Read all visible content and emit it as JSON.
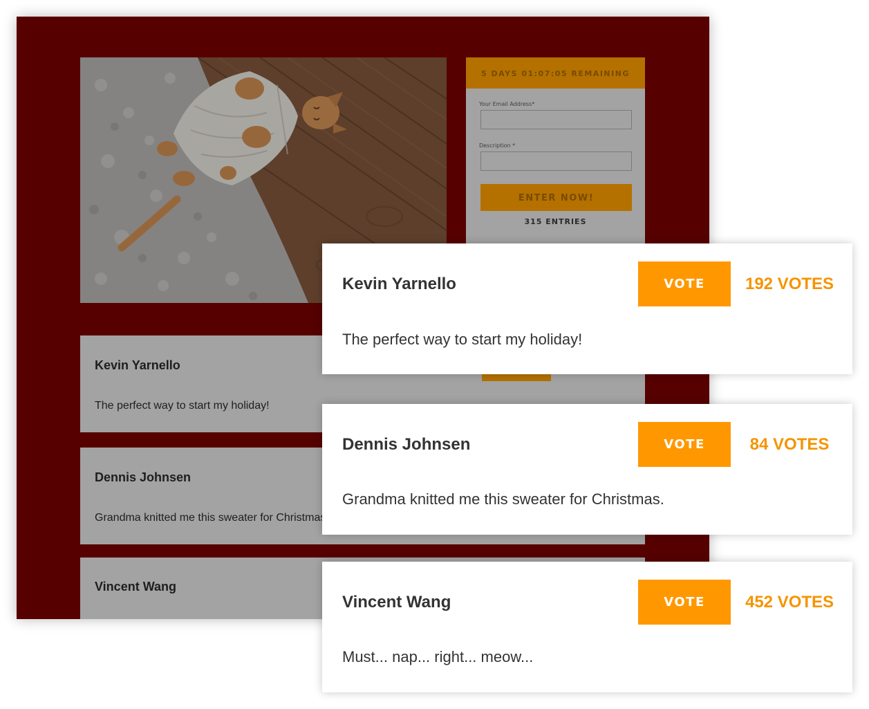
{
  "background_page": {
    "hero_image": {
      "icon": "kitten-in-sweater-photo"
    },
    "contest_form": {
      "timer": "5 DAYS 01:07:05 REMAINING",
      "email_label": "Your Email Address*",
      "email_value": "",
      "description_label": "Description *",
      "description_value": "",
      "submit_label": "ENTER NOW!",
      "entries_count": "315 ENTRIES"
    },
    "entries": [
      {
        "name": "Kevin Yarnello",
        "description": "The perfect way to start my holiday!"
      },
      {
        "name": "Dennis Johnsen",
        "description": "Grandma knitted me this sweater for Christmas."
      },
      {
        "name": "Vincent Wang",
        "description": ""
      }
    ]
  },
  "entries": [
    {
      "name": "Kevin Yarnello",
      "vote_label": "VOTE",
      "votes": "192 VOTES",
      "description": "The perfect way to start my holiday!"
    },
    {
      "name": "Dennis Johnsen",
      "vote_label": "VOTE",
      "votes": "84 VOTES",
      "description": "Grandma knitted me this sweater for Christmas."
    },
    {
      "name": "Vincent Wang",
      "vote_label": "VOTE",
      "votes": "452 VOTES",
      "description": "Must... nap... right... meow..."
    }
  ],
  "colors": {
    "background_page": "#560000",
    "accent": "#ff9800",
    "vote_count": "#f59400",
    "text": "#333333"
  }
}
